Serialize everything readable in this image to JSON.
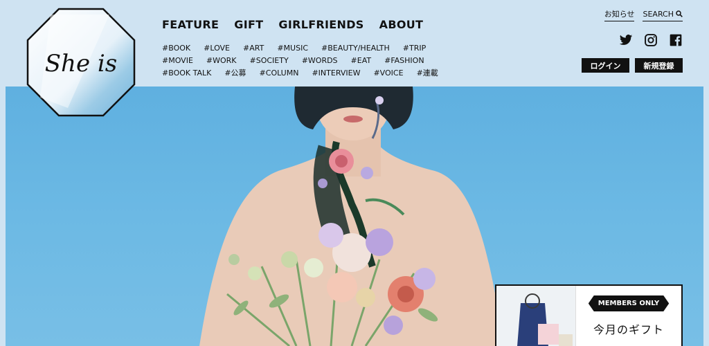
{
  "brand": {
    "logo_text": "She is"
  },
  "main_nav": [
    "FEATURE",
    "GIFT",
    "GIRLFRIENDS",
    "ABOUT"
  ],
  "tags": [
    [
      "#BOOK",
      "#LOVE",
      "#ART",
      "#MUSIC",
      "#BEAUTY/HEALTH",
      "#TRIP"
    ],
    [
      "#MOVIE",
      "#WORK",
      "#SOCIETY",
      "#WORDS",
      "#EAT",
      "#FASHION"
    ],
    [
      "#BOOK TALK",
      "#公募",
      "#COLUMN",
      "#INTERVIEW",
      "#VOICE",
      "#連載"
    ]
  ],
  "utility": {
    "news": "お知らせ",
    "search": "SEARCH"
  },
  "social": [
    "twitter-icon",
    "instagram-icon",
    "facebook-icon"
  ],
  "auth": {
    "login": "ログイン",
    "register": "新規登録"
  },
  "members": {
    "badge": "MEMBERS ONLY",
    "title": "今月のギフト"
  },
  "colors": {
    "page_bg": "#cfe3f2",
    "hero_bg": "#6cb9e4",
    "ink": "#111111"
  }
}
